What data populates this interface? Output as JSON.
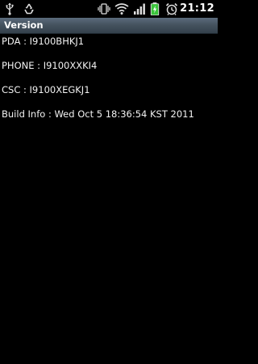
{
  "status_bar": {
    "time": "21:12",
    "icons": [
      "usb-icon",
      "recycle-icon",
      "vibrate-icon",
      "wifi-icon",
      "signal-icon",
      "battery-icon",
      "alarm-icon"
    ]
  },
  "title_bar": {
    "title": "Version"
  },
  "info": {
    "pda": "PDA : I9100BHKJ1",
    "phone": "PHONE : I9100XXKI4",
    "csc": "CSC : I9100XEGKJ1",
    "build": "Build Info : Wed Oct  5 18:36:54 KST 2011"
  },
  "colors": {
    "background": "#000000",
    "title_bar": "#45535f",
    "battery": "#39c43a",
    "text": "#ffffff"
  }
}
